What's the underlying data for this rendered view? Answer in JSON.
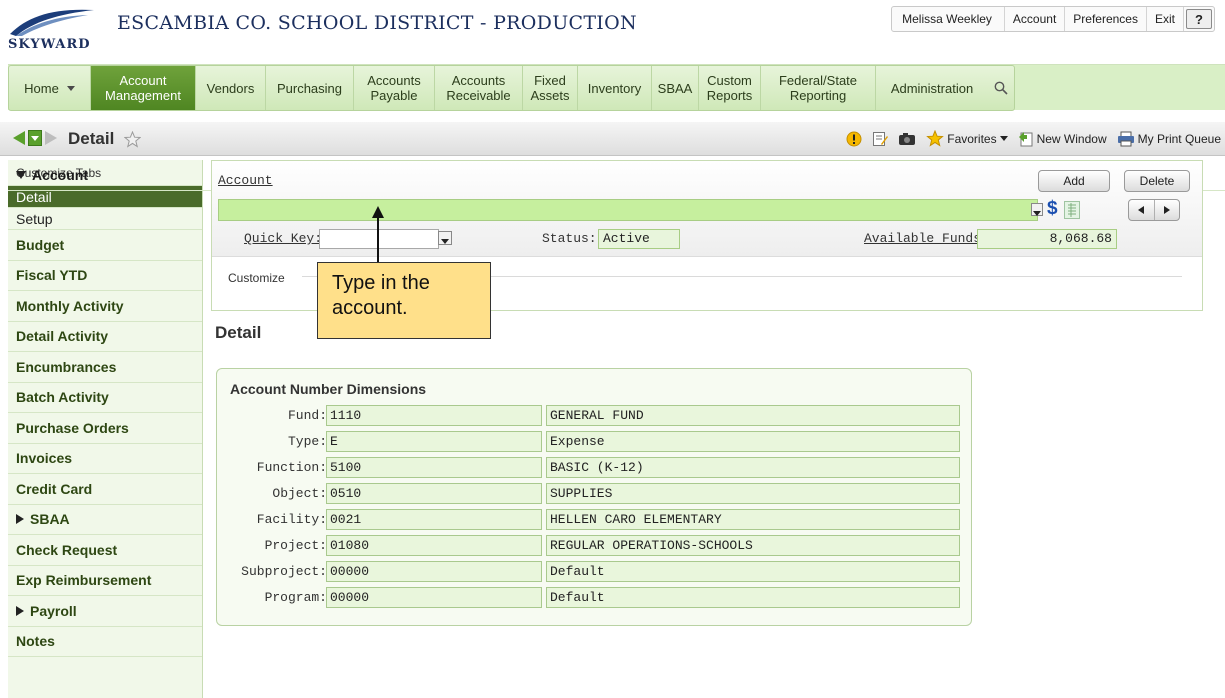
{
  "header": {
    "logo_text": "SKYWARD",
    "title": "ESCAMBIA CO. SCHOOL DISTRICT - PRODUCTION",
    "user": "Melissa Weekley",
    "links": [
      "Account",
      "Preferences",
      "Exit"
    ],
    "help_label": "?"
  },
  "nav": {
    "items": [
      {
        "label": "Home",
        "has_caret": true
      },
      {
        "label": "Account Management",
        "active": true
      },
      {
        "label": "Vendors"
      },
      {
        "label": "Purchasing"
      },
      {
        "label": "Accounts Payable"
      },
      {
        "label": "Accounts Receivable"
      },
      {
        "label": "Fixed Assets"
      },
      {
        "label": "Inventory"
      },
      {
        "label": "SBAA"
      },
      {
        "label": "Custom Reports"
      },
      {
        "label": "Federal/State Reporting"
      },
      {
        "label": "Administration"
      }
    ],
    "search_icon": "search-icon"
  },
  "toolbar": {
    "page_title": "Detail",
    "favorites_label": "Favorites",
    "new_window_label": "New Window",
    "print_queue_label": "My Print Queue"
  },
  "sidebar": {
    "customize_tabs": "Customize Tabs",
    "account_header": "Account",
    "items": [
      {
        "label": "Detail",
        "type": "sub",
        "active": true
      },
      {
        "label": "Setup",
        "type": "sub"
      },
      {
        "label": "Budget"
      },
      {
        "label": "Fiscal YTD"
      },
      {
        "label": "Monthly Activity"
      },
      {
        "label": "Detail Activity"
      },
      {
        "label": "Encumbrances"
      },
      {
        "label": "Batch Activity"
      },
      {
        "label": "Purchase Orders"
      },
      {
        "label": "Invoices"
      },
      {
        "label": "Credit Card"
      },
      {
        "label": "SBAA",
        "collapsible": true
      },
      {
        "label": "Check Request"
      },
      {
        "label": "Exp Reimbursement"
      },
      {
        "label": "Payroll",
        "collapsible": true
      },
      {
        "label": "Notes"
      }
    ]
  },
  "account": {
    "label": "Account",
    "add_label": "Add",
    "delete_label": "Delete",
    "input_value": "",
    "dollar_symbol": "$",
    "quick_key_label": "Quick Key:",
    "quick_key_value": "",
    "status_label": "Status:",
    "status_value": "Active",
    "funds_label": "Available Funds:",
    "funds_value": "8,068.68",
    "customize_label": "Customize"
  },
  "callout": {
    "text": "Type in the account."
  },
  "detail": {
    "heading": "Detail",
    "dims_title": "Account Number Dimensions",
    "rows": [
      {
        "label": "Fund:",
        "code": "1110",
        "desc": "GENERAL FUND"
      },
      {
        "label": "Type:",
        "code": "E",
        "desc": "Expense"
      },
      {
        "label": "Function:",
        "code": "5100",
        "desc": "BASIC (K-12)"
      },
      {
        "label": "Object:",
        "code": "0510",
        "desc": "SUPPLIES"
      },
      {
        "label": "Facility:",
        "code": "0021",
        "desc": "HELLEN CARO ELEMENTARY"
      },
      {
        "label": "Project:",
        "code": "01080",
        "desc": "REGULAR OPERATIONS-SCHOOLS"
      },
      {
        "label": "Subproject:",
        "code": "00000",
        "desc": "Default"
      },
      {
        "label": "Program:",
        "code": "00000",
        "desc": "Default"
      }
    ]
  },
  "colors": {
    "brand_navy": "#1c2f5e",
    "nav_active": "#4f8622",
    "sidebar_active": "#4a6b2a",
    "input_green": "#c6ef9e",
    "callout_yellow": "#ffe08a"
  }
}
